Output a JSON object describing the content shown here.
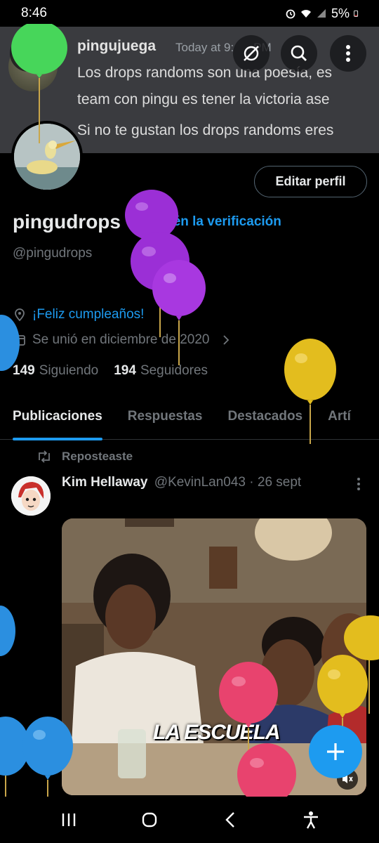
{
  "status_bar": {
    "time": "8:46",
    "battery": "5%"
  },
  "banner": {
    "username": "pingujuega",
    "timestamp": "Today at 9:",
    "timestamp_tail": "PM",
    "line1": "Los drops randoms son una poesía, es",
    "line2": "team con pingu es tener la victoria ase",
    "line3": "Si no te gustan los drops randoms eres"
  },
  "profile": {
    "name": "pingudrops",
    "verify_label": "Obtén la verificación",
    "handle": "@pingudrops",
    "birthday": "¡Feliz cumpleaños!",
    "joined": "Se unió en diciembre de 2020",
    "following_count": "149",
    "following_label": "Siguiendo",
    "followers_count": "194",
    "followers_label": "Seguidores",
    "edit_button": "Editar perfil"
  },
  "tabs": [
    "Publicaciones",
    "Respuestas",
    "Destacados",
    "Artí"
  ],
  "post": {
    "repost_label": "Reposteaste",
    "author_name": "Kim Hellaway",
    "author_handle": "@KevinLan043",
    "separator": "·",
    "date": "26 sept",
    "media_caption": "LA ESCUELA"
  },
  "icons": {
    "back": "arrow-left-icon",
    "grok": "grok-icon",
    "search": "search-icon",
    "more": "more-vertical-icon",
    "location": "location-pin-icon",
    "calendar": "calendar-icon",
    "repost": "repost-icon",
    "compose": "plus-icon",
    "mute": "mute-icon"
  },
  "colors": {
    "accent": "#1d9bf0",
    "background": "#000000",
    "text_primary": "#e7e9ea",
    "text_secondary": "#71767b",
    "balloon_purple": "#9b2fd6",
    "balloon_yellow": "#e3bd1e",
    "balloon_blue": "#2b8fe0",
    "balloon_pink": "#e8436e",
    "balloon_green": "#47d65a"
  }
}
